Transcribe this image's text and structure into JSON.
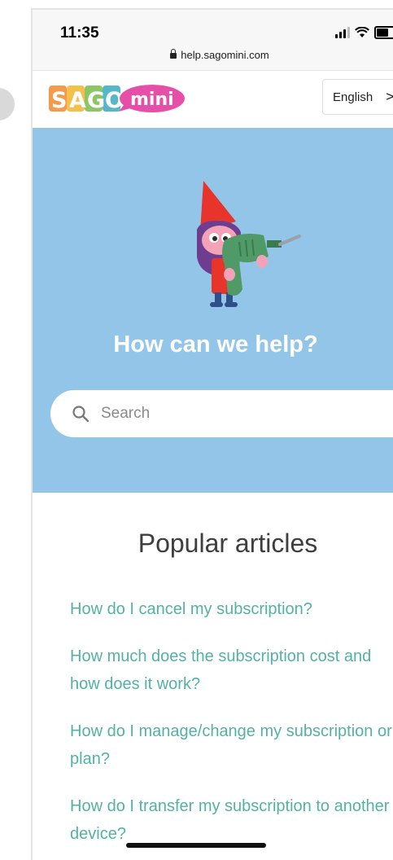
{
  "status_bar": {
    "time": "11:35",
    "url": "help.sagomini.com",
    "icons": [
      "signal-icon",
      "wifi-icon",
      "battery-icon"
    ]
  },
  "header": {
    "logo_text": "SAGO mini",
    "language_label": "English",
    "language_chevron": ">"
  },
  "hero": {
    "background": "#93c5e8",
    "title": "How can we help?",
    "search_placeholder": "Search"
  },
  "popular": {
    "title": "Popular articles",
    "link_color": "#53b1a6",
    "articles": [
      "How do I cancel my subscription?",
      "How much does the subscription cost and how does it work?",
      "How do I manage/change my subscription or plan?",
      "How do I transfer my subscription to another device?"
    ]
  }
}
